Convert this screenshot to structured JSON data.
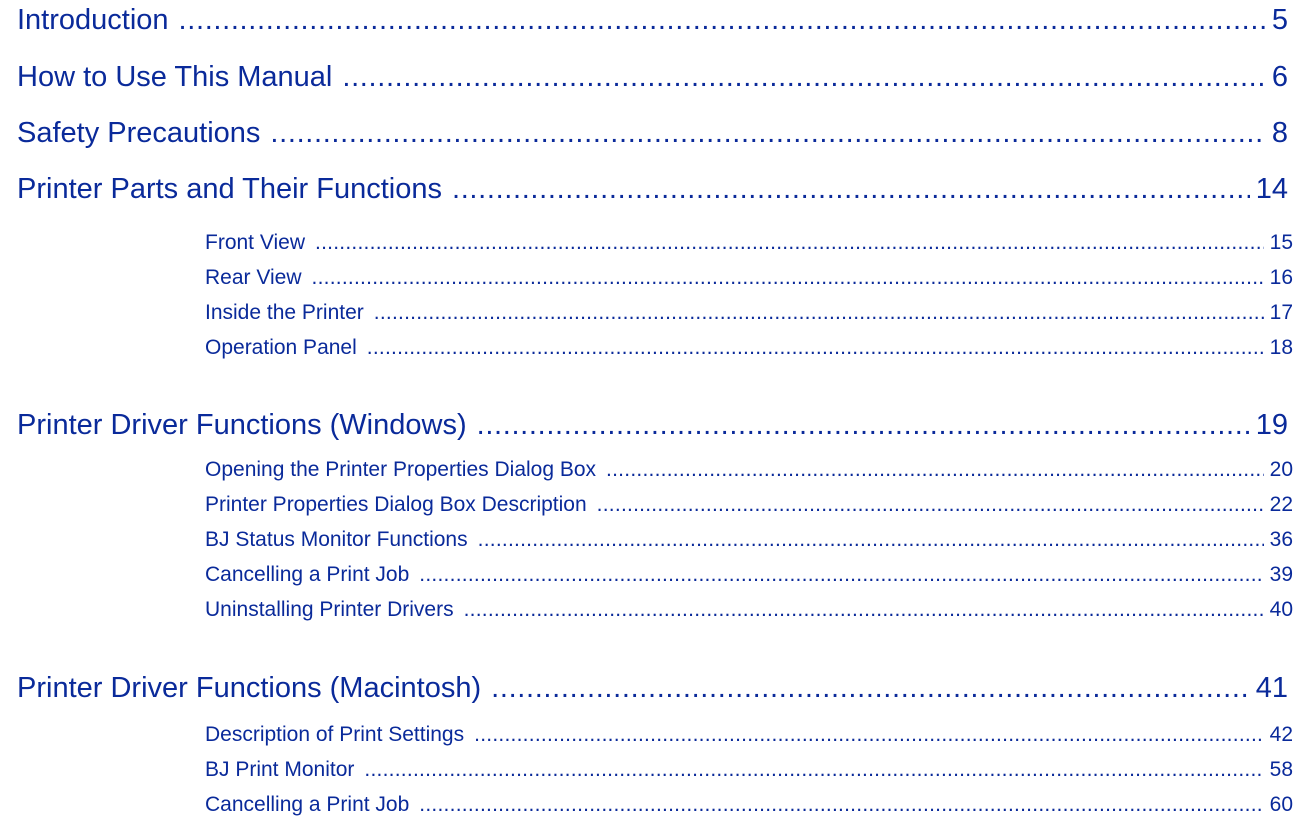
{
  "toc": {
    "introduction": {
      "label": "Introduction",
      "page": "5"
    },
    "how_to_use": {
      "label": "How to Use This Manual",
      "page": "6"
    },
    "safety": {
      "label": "Safety Precautions",
      "page": "8"
    },
    "printer_parts": {
      "label": "Printer Parts and Their Functions",
      "page": "14",
      "items": [
        {
          "label": "Front View",
          "page": "15"
        },
        {
          "label": "Rear View",
          "page": "16"
        },
        {
          "label": "Inside the Printer",
          "page": "17"
        },
        {
          "label": "Operation Panel",
          "page": "18"
        }
      ]
    },
    "driver_windows": {
      "label": "Printer Driver Functions (Windows)",
      "page": "19",
      "items": [
        {
          "label": "Opening the Printer Properties Dialog Box",
          "page": "20"
        },
        {
          "label": "Printer Properties Dialog Box Description",
          "page": "22"
        },
        {
          "label": "BJ Status Monitor Functions",
          "page": "36"
        },
        {
          "label": "Cancelling a Print Job",
          "page": "39"
        },
        {
          "label": "Uninstalling Printer Drivers",
          "page": "40"
        }
      ]
    },
    "driver_mac": {
      "label": "Printer Driver Functions (Macintosh)",
      "page": "41",
      "items": [
        {
          "label": "Description of Print Settings",
          "page": "42"
        },
        {
          "label": "BJ Print Monitor",
          "page": "58"
        },
        {
          "label": "Cancelling a Print Job",
          "page": "60"
        }
      ]
    }
  }
}
